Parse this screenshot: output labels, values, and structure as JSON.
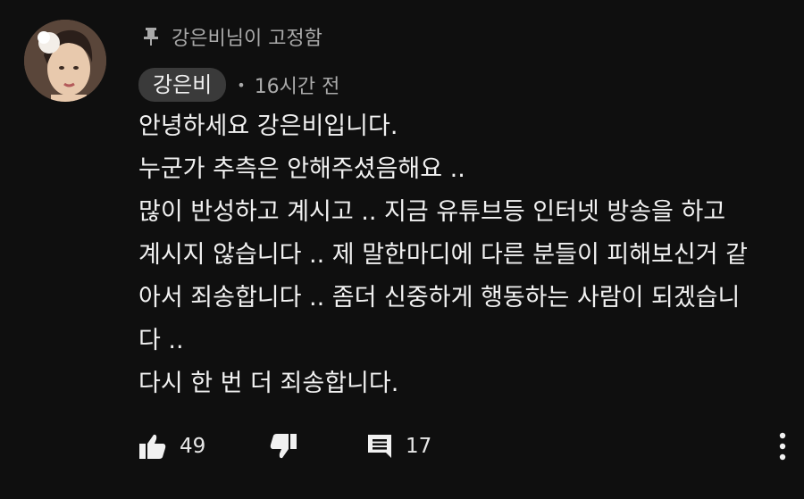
{
  "pinned": {
    "text": "강은비님이 고정함",
    "icon": "pin-icon"
  },
  "author": {
    "name": "강은비",
    "separator": "•",
    "time": "16시간 전"
  },
  "comment": {
    "lines": [
      "안녕하세요 강은비입니다.",
      "누군가 추측은 안해주셨음해요 ..",
      "많이 반성하고 계시고 .. 지금 유튜브등 인터넷 방송을 하고",
      "계시지 않습니다 .. 제 말한마디에 다른 분들이 피해보신거 같",
      "아서 죄송합니다 .. 좀더 신중하게 행동하는 사람이 되겠습니",
      "다 ..",
      "다시 한 번 더 죄송합니다."
    ]
  },
  "actions": {
    "like_count": "49",
    "reply_count": "17",
    "icons": [
      "thumbs-up-icon",
      "thumbs-down-icon",
      "comment-icon",
      "more-vertical-icon"
    ]
  },
  "colors": {
    "background": "#0f0f0f",
    "text": "#f1f1f1",
    "secondary": "#aaaaaa",
    "chip": "#3a3a3a"
  }
}
